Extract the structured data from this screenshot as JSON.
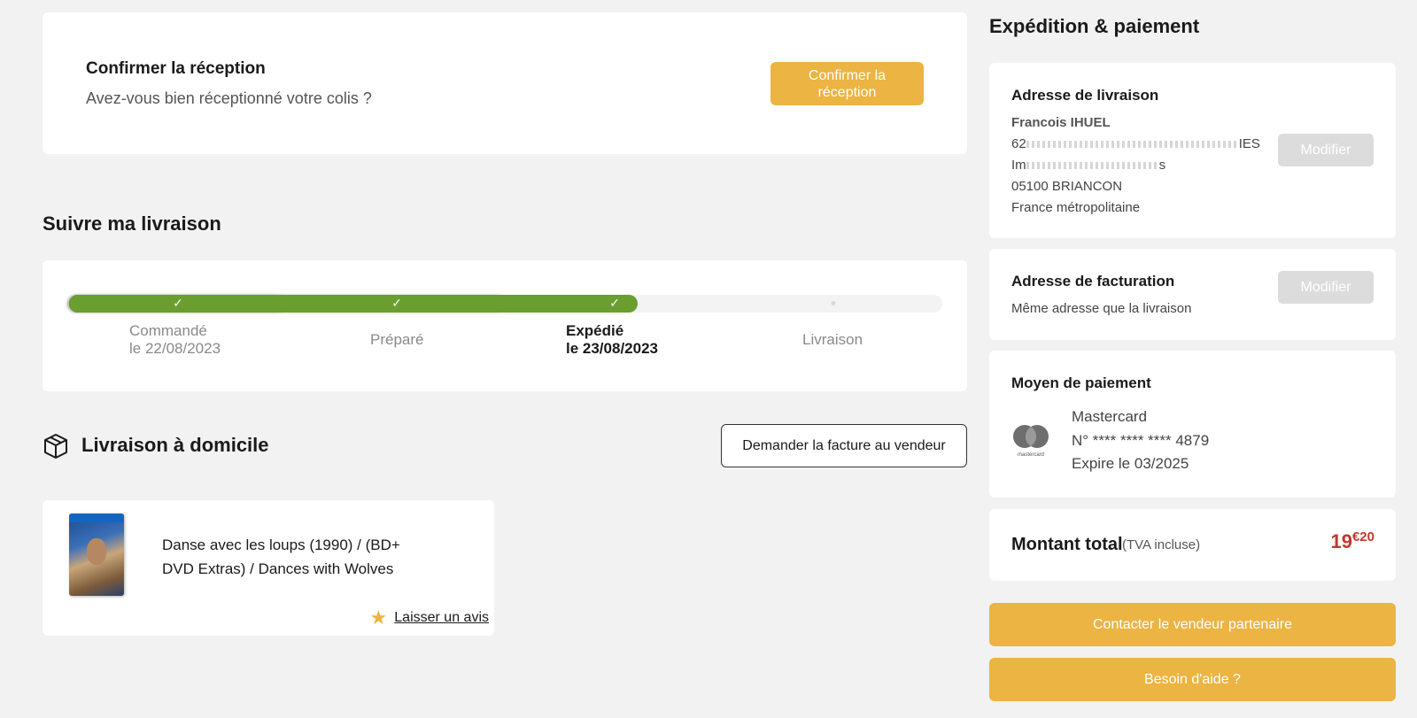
{
  "confirm": {
    "title": "Confirmer la réception",
    "subtitle": "Avez-vous bien réceptionné votre colis ?",
    "button": "Confirmer la réception"
  },
  "tracking": {
    "title": "Suivre ma livraison",
    "progress_steps_completed": 3,
    "progress_steps_total": 4,
    "steps": [
      {
        "label": "Commandé",
        "date": "le 22/08/2023",
        "done": true
      },
      {
        "label": "Préparé",
        "date": "",
        "done": true
      },
      {
        "label": "Expédié",
        "date": "le 23/08/2023",
        "done": true,
        "current": true
      },
      {
        "label": "Livraison",
        "date": "",
        "done": false
      }
    ]
  },
  "home": {
    "title": "Livraison à domicile",
    "invoice_button": "Demander la facture au vendeur",
    "product": {
      "name_line1": "Danse avec les loups (1990) / (BD+",
      "name_line2": "DVD Extras) / Dances with Wolves",
      "review_link": "Laisser un avis"
    }
  },
  "shipping": {
    "title": "Expédition & paiement",
    "address": {
      "title": "Adresse de livraison",
      "name": "Francois IHUEL",
      "line1_start": "62",
      "line1_end": "IES",
      "line2_start": "Im",
      "line2_end": "s",
      "city": "05100 BRIANCON",
      "country": "France métropolitaine",
      "modify": "Modifier"
    },
    "billing": {
      "title": "Adresse de facturation",
      "subtitle": "Même adresse que la livraison",
      "modify": "Modifier"
    },
    "payment": {
      "title": "Moyen de paiement",
      "logo_text": "mastercard",
      "brand": "Mastercard",
      "number": "N° **** **** **** 4879",
      "expiry": "Expire le 03/2025"
    },
    "total": {
      "label": "Montant total",
      "vat": "(TVA incluse)",
      "price_int": "19",
      "price_cents": "€20"
    },
    "contact_button": "Contacter le vendeur partenaire",
    "help_button": "Besoin d'aide ?"
  },
  "colors": {
    "accent": "#ebb443",
    "progress": "#6a9e2f",
    "price": "#c0392b"
  }
}
